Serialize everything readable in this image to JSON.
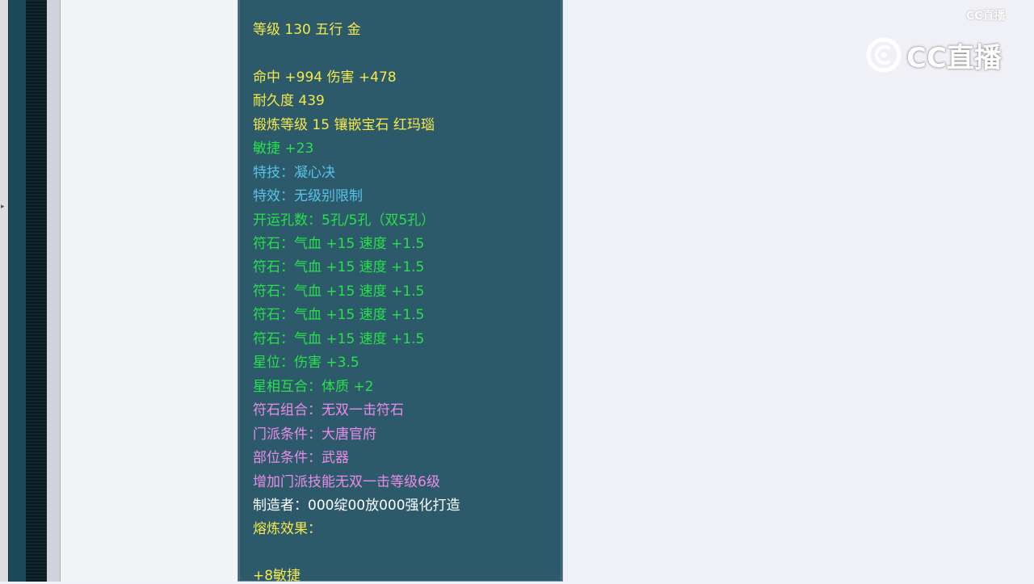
{
  "colors": {
    "panel_bg": "#2d5a6b",
    "yellow": "#f5e94a",
    "green": "#28e04a",
    "blue": "#58c2e8",
    "pink": "#e98be8",
    "white": "#ffffff"
  },
  "tooltip": {
    "level_line": "等级 130 五行 金",
    "hit_damage": "命中 +994 伤害 +478",
    "durability": "耐久度 439",
    "forge": "锻炼等级 15 镶嵌宝石 红玛瑙",
    "agility": "敏捷 +23",
    "special_skill": "特技：凝心决",
    "special_effect": "特效：无级别限制",
    "holes": "开运孔数：5孔/5孔（双5孔）",
    "runes": [
      "符石：气血 +15 速度 +1.5",
      "符石：气血 +15 速度 +1.5",
      "符石：气血 +15 速度 +1.5",
      "符石：气血 +15 速度 +1.5",
      "符石：气血 +15 速度 +1.5"
    ],
    "star_position": "星位：伤害 +3.5",
    "star_combo": "星相互合：体质 +2",
    "rune_combo": "符石组合：无双一击符石",
    "sect_req": "门派条件：大唐官府",
    "part_req": "部位条件：武器",
    "skill_bonus": "增加门派技能无双一击等级6级",
    "maker": "制造者：000绽00放000强化打造",
    "smelt_label": "熔炼效果：",
    "smelt_value": "+8敏捷"
  },
  "watermark": {
    "small_text": "CC直播",
    "large_text": "CC直播",
    "logo_icon": "cc-live-logo-icon"
  }
}
